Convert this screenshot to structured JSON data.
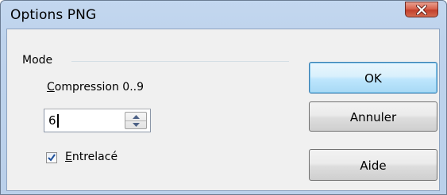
{
  "window": {
    "title": "Options PNG"
  },
  "mode_group": {
    "label": "Mode",
    "compression_label": "Compression 0..9",
    "compression_mnemonic": "C",
    "compression_rest": "ompression 0..9",
    "compression_value": "6",
    "interlaced_label": "Entrelacé",
    "interlaced_mnemonic": "E",
    "interlaced_rest": "ntrelacé",
    "interlaced_checked": true
  },
  "buttons": {
    "ok": "OK",
    "cancel": "Annuler",
    "help": "Aide"
  },
  "colors": {
    "close_button": "#c7462f",
    "checkbox_mark": "#1d4f9a",
    "default_button_border": "#3c7fb1"
  }
}
